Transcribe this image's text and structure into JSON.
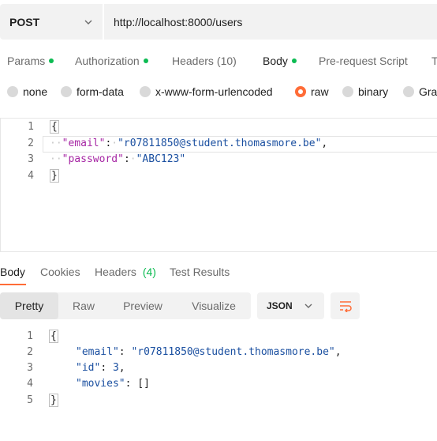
{
  "request": {
    "method": "POST",
    "url": "http://localhost:8000/users"
  },
  "request_tabs": [
    {
      "label": "Params",
      "dot": true
    },
    {
      "label": "Authorization",
      "dot": true
    },
    {
      "label": "Headers",
      "count": "(10)"
    },
    {
      "label": "Body",
      "dot": true,
      "active": true
    },
    {
      "label": "Pre-request Script"
    },
    {
      "label": "T"
    }
  ],
  "body_types": [
    {
      "label": "none"
    },
    {
      "label": "form-data"
    },
    {
      "label": "x-www-form-urlencoded"
    },
    {
      "label": "raw",
      "selected": true
    },
    {
      "label": "binary"
    },
    {
      "label": "Grap"
    }
  ],
  "request_body": {
    "line_numbers": [
      "1",
      "2",
      "3",
      "4"
    ],
    "email_key": "\"email\"",
    "email_value": "\"r07811850@student.thomasmore.be\"",
    "password_key": "\"password\"",
    "password_value": "\"ABC123\""
  },
  "response_tabs": [
    {
      "label": "Body",
      "active": true
    },
    {
      "label": "Cookies"
    },
    {
      "label": "Headers",
      "count": "(4)"
    },
    {
      "label": "Test Results"
    }
  ],
  "response_views": [
    {
      "label": "Pretty",
      "active": true
    },
    {
      "label": "Raw"
    },
    {
      "label": "Preview"
    },
    {
      "label": "Visualize"
    }
  ],
  "response_format": "JSON",
  "response_body": {
    "line_numbers": [
      "1",
      "2",
      "3",
      "4",
      "5"
    ],
    "email_key": "\"email\"",
    "email_value": "\"r07811850@student.thomasmore.be\"",
    "id_key": "\"id\"",
    "id_value": "3",
    "movies_key": "\"movies\"",
    "movies_value": "[]"
  },
  "colors": {
    "accent": "#ff6c37",
    "status_dot": "#0cbb52",
    "json_key": "#a626a4",
    "json_value": "#1a4fa0"
  },
  "icons": {
    "method_dropdown": "chevron-down-icon",
    "format_dropdown": "chevron-down-icon",
    "wrap": "wrap-lines-icon"
  }
}
